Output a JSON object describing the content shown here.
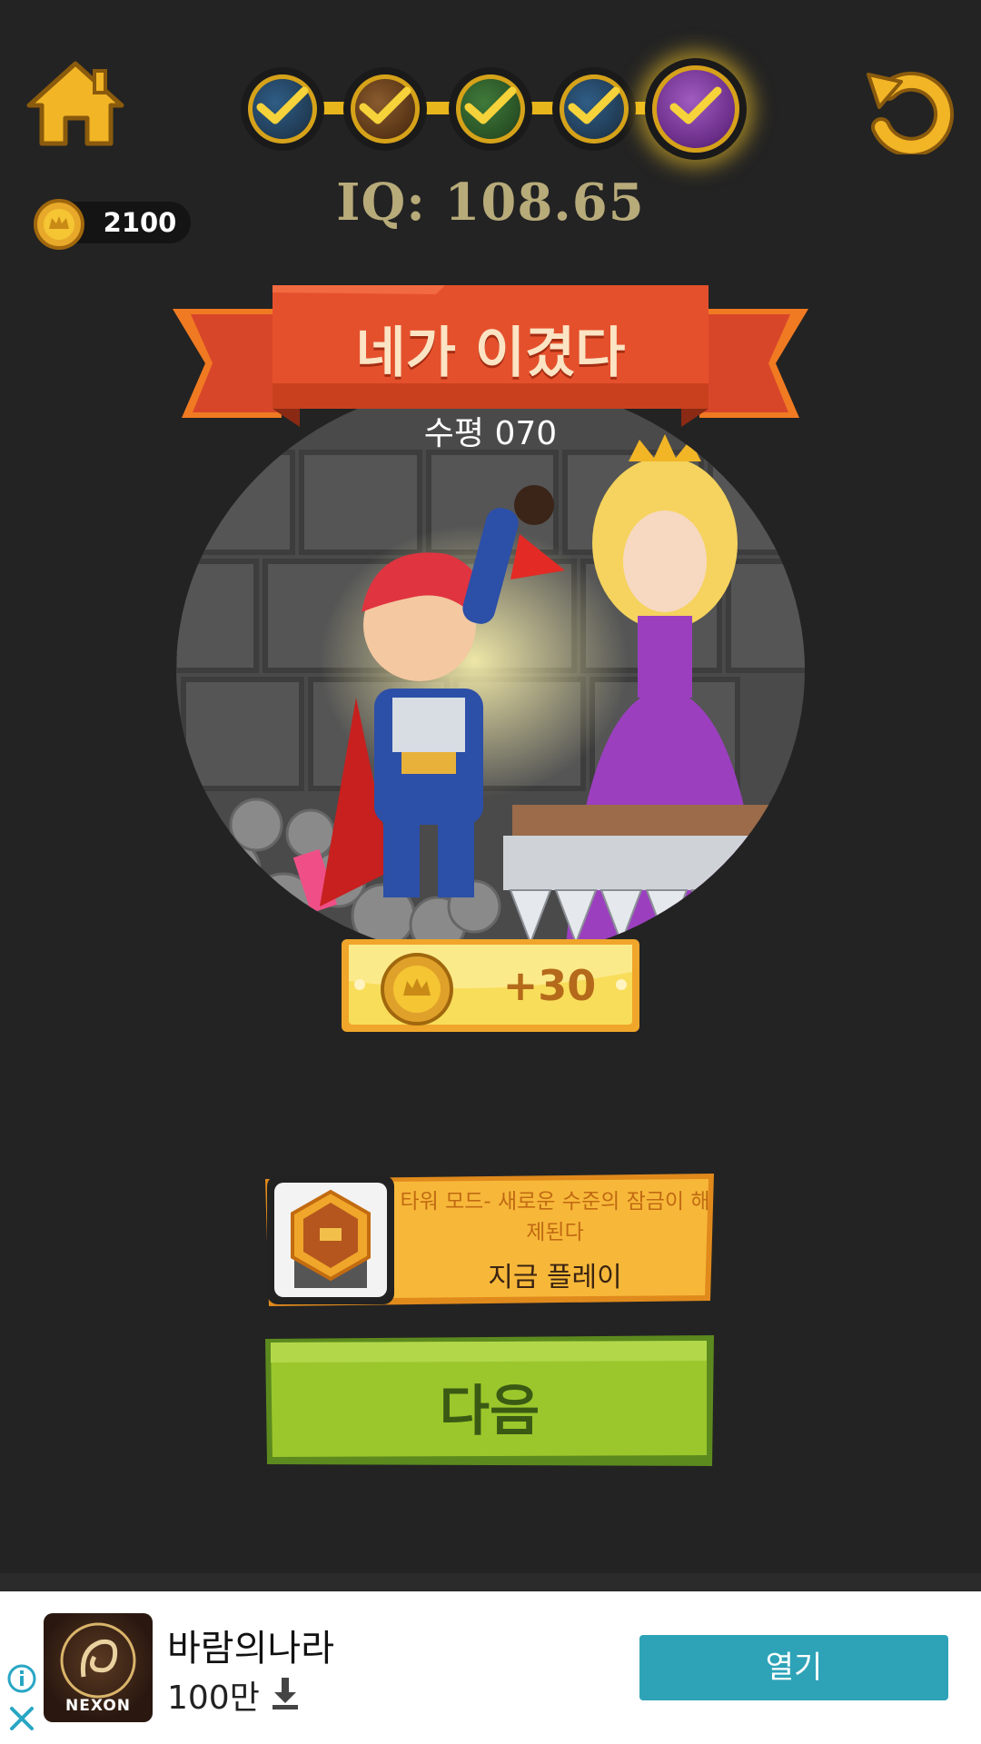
{
  "header": {
    "home_icon": "house-icon",
    "restart_icon": "restart-arrow-icon",
    "iq_text": "IQ: 108.65",
    "coins": "2100"
  },
  "stages": [
    {
      "status": "completed",
      "icon": "check-icon"
    },
    {
      "status": "completed",
      "icon": "check-icon"
    },
    {
      "status": "completed",
      "icon": "check-icon"
    },
    {
      "status": "completed",
      "icon": "check-icon"
    },
    {
      "status": "current",
      "icon": "check-icon"
    }
  ],
  "result": {
    "title": "네가 이겼다",
    "level": "수평 070",
    "reward": "+30"
  },
  "tower_mode": {
    "description": "타워 모드- 새로운 수준의 잠금이 해제된다",
    "play_label": "지금 플레이"
  },
  "next_button": {
    "label": "다음"
  },
  "ad": {
    "app_name": "바람의나라",
    "downloads": "100만",
    "brand": "NEXON",
    "open_label": "열기"
  },
  "colors": {
    "background": "#232323",
    "banner_red": "#e5502c",
    "gold": "#f5c534",
    "next_green": "#9cc72c",
    "ad_button": "#2ea3b8"
  }
}
